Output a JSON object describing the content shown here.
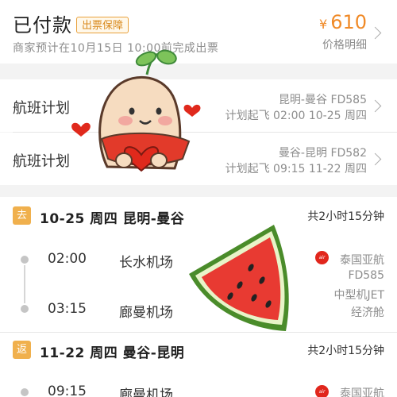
{
  "header": {
    "status": "已付款",
    "badge": "出票保障",
    "subtitle": "商家预计在10月15日 10:00前完成出票",
    "currency": "¥",
    "price": "610",
    "price_detail": "价格明细"
  },
  "plans": [
    {
      "label": "航班计划",
      "route": "昆明-曼谷 FD585",
      "time": "计划起飞 02:00 10-25 周四"
    },
    {
      "label": "航班计划",
      "route": "曼谷-昆明 FD582",
      "time": "计划起飞 09:15 11-22 周四"
    }
  ],
  "legs": [
    {
      "tag": "去",
      "title": "10-25 周四 昆明-曼谷",
      "duration": "共2小时15分钟",
      "depart_time": "02:00",
      "depart_airport": "长水机场",
      "arrive_time": "03:15",
      "arrive_airport": "廊曼机场",
      "airline": "泰国亚航",
      "flight": "FD585",
      "aircraft": "中型机JET",
      "cabin": "经济舱"
    },
    {
      "tag": "返",
      "title": "11-22 周四 曼谷-昆明",
      "duration": "共2小时15分钟",
      "depart_time": "09:15",
      "depart_airport": "廊曼机场",
      "airline": "泰国亚航"
    }
  ],
  "icons": {
    "chevron": "chevron-right-icon",
    "airline_logo": "airasia-logo-icon"
  },
  "colors": {
    "accent": "#f08a27",
    "tag": "#f0b04d",
    "airline": "#e1261c"
  }
}
